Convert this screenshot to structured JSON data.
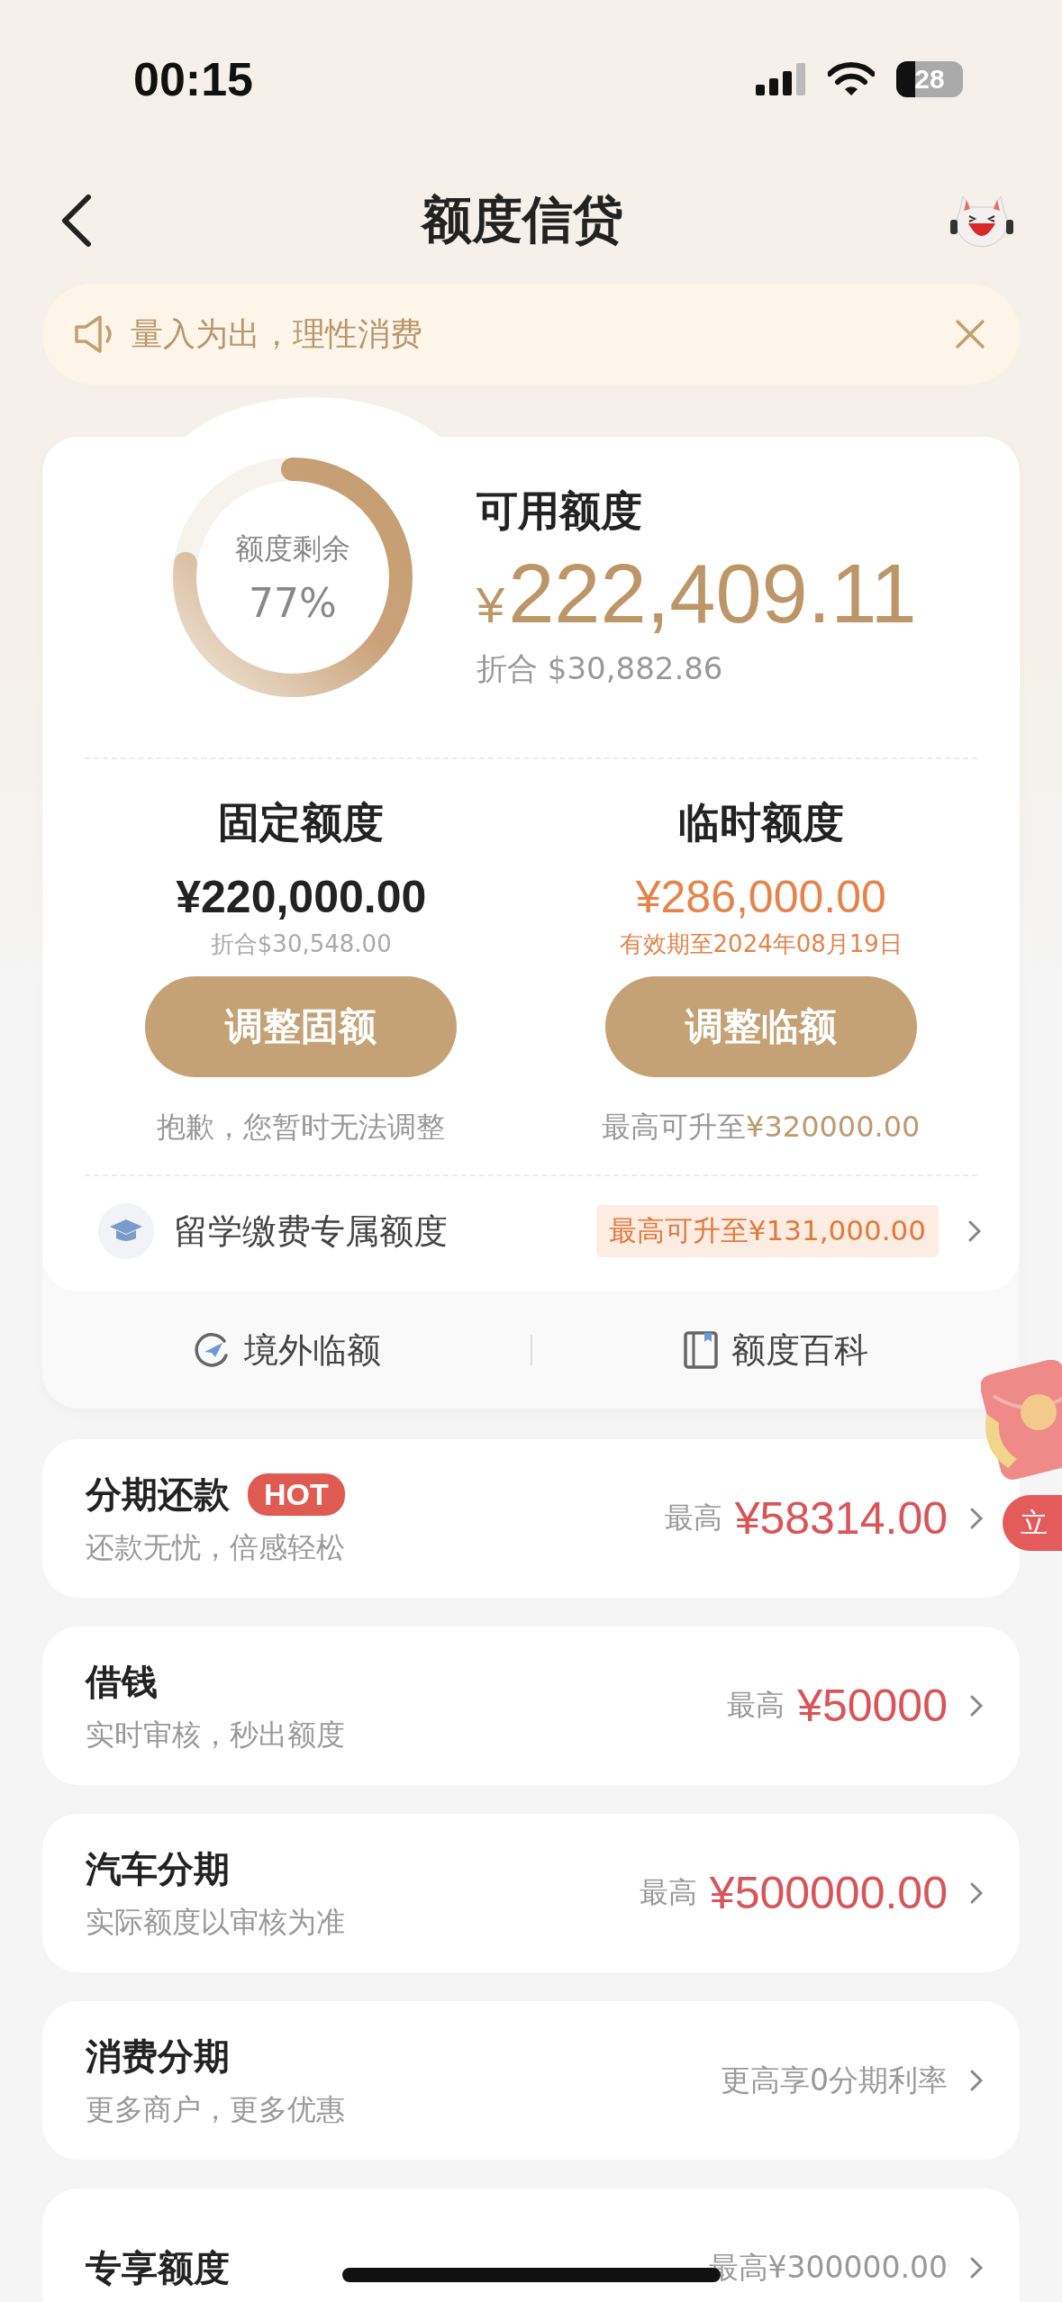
{
  "status_bar": {
    "time": "00:15",
    "battery": "28"
  },
  "nav": {
    "title": "额度信贷"
  },
  "notice": {
    "text": "量入为出，理性消费"
  },
  "credit": {
    "ring_label": "额度剩余",
    "ring_percent": "77%",
    "level": 0.77,
    "available_label": "可用额度",
    "currency": "¥",
    "amount": "222,409.11",
    "converted": "折合 $30,882.86"
  },
  "quotas": [
    {
      "kind": "fixed",
      "title": "固定额度",
      "amount": "¥220,000.00",
      "note": "折合$30,548.00",
      "button": "调整固额",
      "footer": "抱歉，您暂时无法调整"
    },
    {
      "kind": "temporary",
      "title": "临时额度",
      "amount": "¥286,000.00",
      "note": "有效期至2024年08月19日",
      "button": "调整临额",
      "footer": "最高可升至",
      "footer_value": "¥320000.00"
    }
  ],
  "study": {
    "label": "留学缴费专属额度",
    "badge": "最高可升至¥131,000.00"
  },
  "links": [
    {
      "kind": "overseas",
      "label": "境外临额"
    },
    {
      "kind": "book",
      "label": "额度百科"
    }
  ],
  "products": [
    {
      "kind": "amount",
      "title": "分期还款",
      "badge": "HOT",
      "subtitle": "还款无忧，倍感轻松",
      "right_label": "最高",
      "right_value": "¥58314.00"
    },
    {
      "kind": "amount",
      "title": "借钱",
      "subtitle": "实时审核，秒出额度",
      "right_label": "最高",
      "right_value": "¥50000"
    },
    {
      "kind": "amount",
      "title": "汽车分期",
      "subtitle": "实际额度以审核为准",
      "right_label": "最高",
      "right_value": "¥500000.00"
    },
    {
      "kind": "text",
      "title": "消费分期",
      "subtitle": "更多商户，更多优惠",
      "right_label": "更高享0分期利率"
    },
    {
      "kind": "text",
      "title": "专享额度",
      "right_label": "最高¥300000.00"
    }
  ],
  "floating": {
    "text": "立"
  }
}
